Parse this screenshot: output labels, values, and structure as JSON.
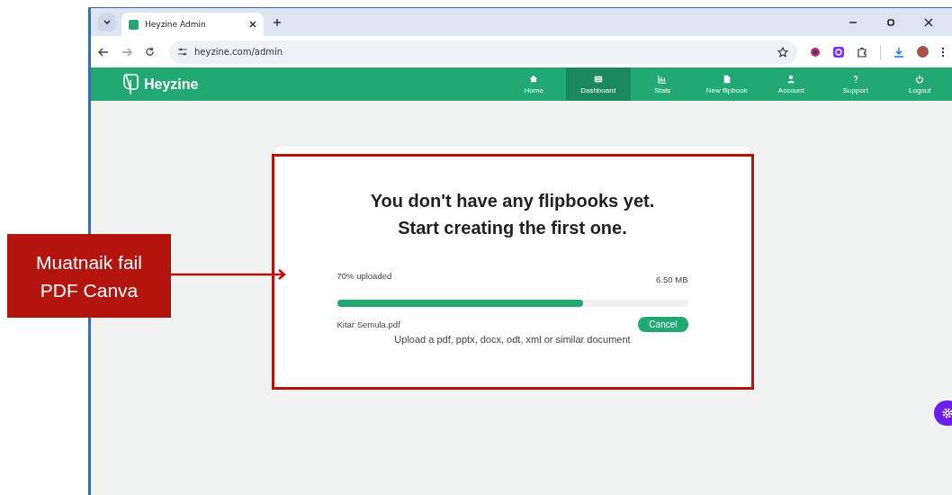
{
  "callout": {
    "text": "Muatnaik fail PDF Canva"
  },
  "browser": {
    "tabs": [
      {
        "title": "Heyzine Admin",
        "selected": true
      }
    ],
    "address": "heyzine.com/admin"
  },
  "app": {
    "brand": "Heyzine",
    "nav": [
      {
        "label": "Home",
        "selected": false
      },
      {
        "label": "Dashboard",
        "selected": true
      },
      {
        "label": "Stats",
        "selected": false
      },
      {
        "label": "New flipbook",
        "selected": false
      },
      {
        "label": "Account",
        "selected": false
      },
      {
        "label": "Support",
        "selected": false
      },
      {
        "label": "Logout",
        "selected": false
      }
    ]
  },
  "upload": {
    "heading": [
      "You don't have any flipbooks yet.",
      "Start creating the first one."
    ],
    "progress_label": "70% uploaded",
    "size": "6.50 MB",
    "level": 0.7,
    "file_name": "Kitar Semula.pdf",
    "cancel": "Cancel",
    "hint": "Upload a pdf, pptx, docx, odt, xml or similar document"
  }
}
